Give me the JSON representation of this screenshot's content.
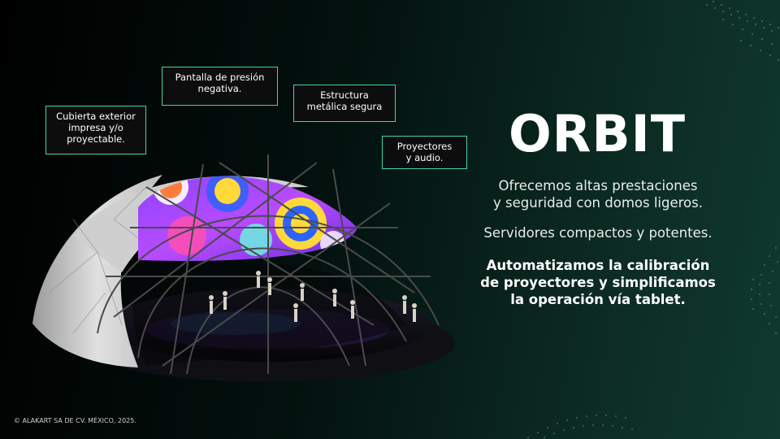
{
  "callouts": {
    "cover": [
      "Cubierta exterior",
      "impresa y/o",
      "proyectable."
    ],
    "screen": [
      "Pantalla de presión",
      "negativa."
    ],
    "structure": [
      "Estructura",
      "metálica segura"
    ],
    "projectors": [
      "Proyectores",
      "y audio."
    ]
  },
  "brand": "ORBIT",
  "paragraphs": {
    "p1": [
      "Ofrecemos altas prestaciones",
      "y seguridad con domos ligeros."
    ],
    "p2": [
      "Servidores compactos y potentes."
    ],
    "p3": [
      "Automatizamos la calibración",
      "de proyectores y simplificamos",
      "la operación vía tablet."
    ]
  },
  "copyright": "© ALAKART SA DE CV. MÉXICO, 2025.",
  "colors": {
    "accent": "#3fd6b0",
    "background_dark": "#000000",
    "background_green": "#103a2f"
  }
}
